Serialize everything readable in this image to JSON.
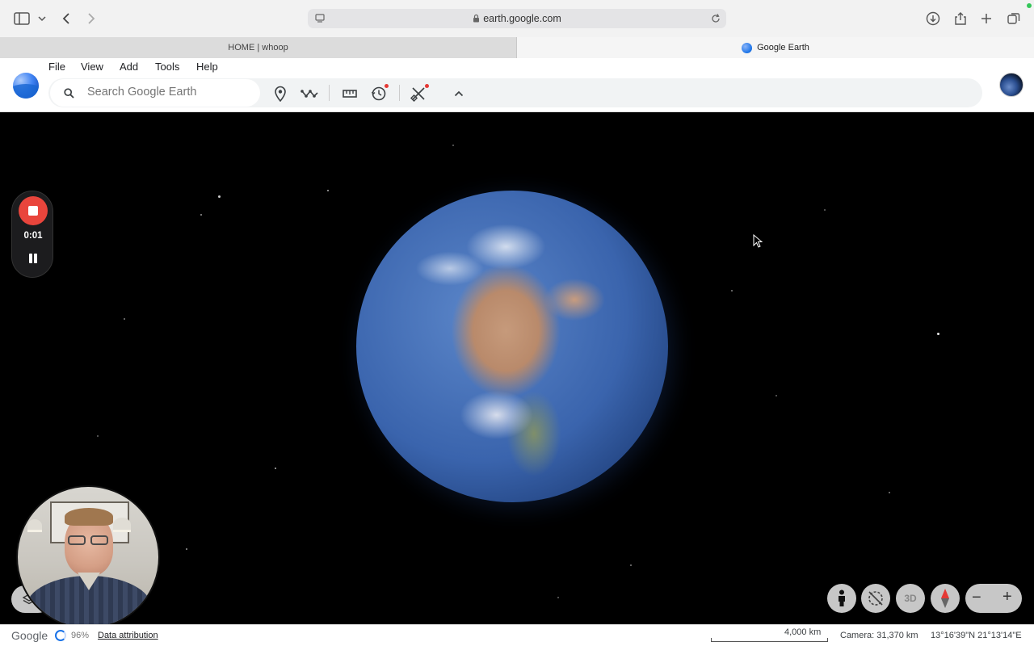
{
  "browser": {
    "url": "earth.google.com",
    "tabs": [
      {
        "label": "HOME | whoop",
        "active": false
      },
      {
        "label": "Google Earth",
        "active": true
      }
    ]
  },
  "menu": [
    "File",
    "View",
    "Add",
    "Tools",
    "Help"
  ],
  "search": {
    "placeholder": "Search Google Earth"
  },
  "recorder": {
    "time": "0:01"
  },
  "controls": {
    "three_d_label": "3D",
    "zoom_out": "−",
    "zoom_in": "+"
  },
  "status": {
    "brand": "Google",
    "loading_percent": "96%",
    "attribution": "Data attribution",
    "scale": "4,000 km",
    "camera": "Camera: 31,370 km",
    "coords": "13°16'39\"N 21°13'14\"E"
  },
  "colors": {
    "record_red": "#e9453c",
    "accent_blue": "#1a73e8"
  }
}
